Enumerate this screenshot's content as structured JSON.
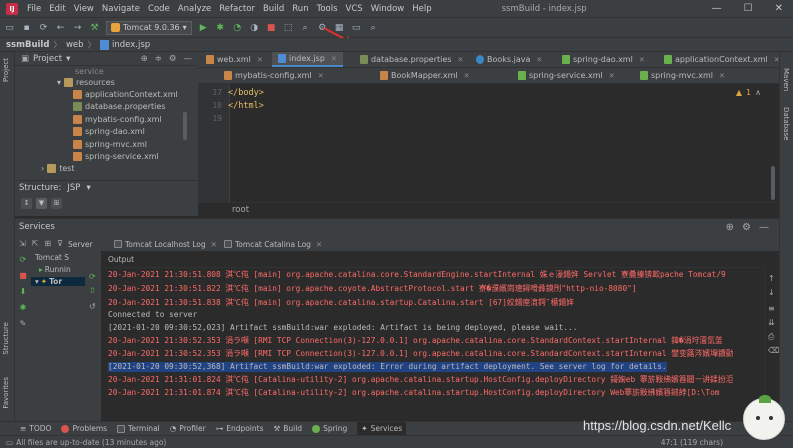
{
  "window": {
    "title": "ssmBuild - index.jsp",
    "menu": [
      "File",
      "Edit",
      "View",
      "Navigate",
      "Code",
      "Analyze",
      "Refactor",
      "Build",
      "Run",
      "Tools",
      "VCS",
      "Window",
      "Help"
    ]
  },
  "toolbar": {
    "run_config": "Tomcat 9.0.36"
  },
  "breadcrumb": [
    "ssmBuild",
    "web",
    "index.jsp"
  ],
  "project_panel": {
    "title": "Project",
    "items": [
      "service",
      "resources",
      "applicationContext.xml",
      "database.properties",
      "mybatis-config.xml",
      "spring-dao.xml",
      "spring-mvc.xml",
      "spring-service.xml",
      "test"
    ]
  },
  "structure_panel": {
    "title": "Structure:",
    "file": "JSP"
  },
  "left_strip": {
    "project": "Project",
    "structure": "Structure",
    "favorites": "Favorites"
  },
  "right_strip": {
    "maven": "Maven",
    "database": "Database"
  },
  "editor": {
    "tabs_row1": [
      "web.xml",
      "index.jsp",
      "database.properties",
      "Books.java",
      "spring-dao.xml",
      "applicationContext.xml"
    ],
    "tabs_row2": [
      "mybatis-config.xml",
      "BookMapper.xml",
      "spring-service.xml",
      "spring-mvc.xml"
    ],
    "active_tab": "index.jsp",
    "lines": [
      {
        "num": "17",
        "text": "</body>"
      },
      {
        "num": "18",
        "text": "</html>"
      },
      {
        "num": "19",
        "text": ""
      }
    ],
    "warning_count": "1",
    "breadcrumb": "root"
  },
  "services": {
    "title": "Services",
    "tabs": [
      "Server",
      "Tomcat Localhost Log",
      "Tomcat Catalina Log"
    ],
    "tree": [
      "Tomcat S",
      "Runnin",
      "Tor"
    ],
    "output_label": "Output",
    "console": [
      {
        "style": "red",
        "text": "20-Jan-2021 21:30:51.808 淇℃伅 [main] org.apache.catalina.core.StandardEngine.startInternal 姝ｅ湪鍚姩 Servlet 寮曟搸锛欰pache Tomcat/9"
      },
      {
        "style": "red",
        "text": "20-Jan-2021 21:30:51.822 淇℃伅 [main] org.apache.coyote.AbstractProtocol.start 寮�濮嬪崗璁鐞嗗彞鏌刐\"http-nio-8080\"]"
      },
      {
        "style": "red",
        "text": "20-Jan-2021 21:30:51.838 淇℃伅 [main] org.apache.catalina.startup.Catalina.start [67]姣鍚庢湇鍔″櫒鍚姩"
      },
      {
        "style": "gray",
        "text": "Connected to server"
      },
      {
        "style": "gray",
        "text": "[2021-01-20 09:30:52,023] Artifact ssmBuild:war exploded: Artifact is being deployed, please wait..."
      },
      {
        "style": "red",
        "text": "20-Jan-2021 21:30:52.353 涓ラ噸 [RMI TCP Connection(3)-127.0.0.1] org.apache.catalina.core.StandardContext.startInternal 鍏�涓垨澶氫釜"
      },
      {
        "style": "red",
        "text": "20-Jan-2021 21:30:52.353 涓ラ噸 [RMI TCP Connection(3)-127.0.0.1] org.apache.catalina.core.StandardContext.startInternal 鐢变簬涔嬪墠鐨勯"
      },
      {
        "style": "hl",
        "text": "[2021-01-20 09:30:52,368] Artifact ssmBuild:war exploded: Error during artifact deployment. See server log for details."
      },
      {
        "style": "red",
        "text": "20-Jan-2021 21:31:01.824 淇℃伅 [Catalina-utility-2] org.apache.catalina.startup.HostConfig.deployDirectory 鎶婅eb 搴旂敤绋嬪簭閮ㄧ讲鍒扮洰"
      },
      {
        "style": "red",
        "text": "20-Jan-2021 21:31:01.874 淇℃伅 [Catalina-utility-2] org.apache.catalina.startup.HostConfig.deployDirectory Web搴旂敤绋嬪簭鐩綍[D:\\Tom"
      }
    ]
  },
  "bottom_tabs": [
    "TODO",
    "Problems",
    "Terminal",
    "Profiler",
    "Endpoints",
    "Build",
    "Spring",
    "Services"
  ],
  "status": {
    "left": "All files are up-to-date (13 minutes ago)",
    "right": "47:1 (119 chars)"
  },
  "watermark": "https://blog.csdn.net/Kellc"
}
